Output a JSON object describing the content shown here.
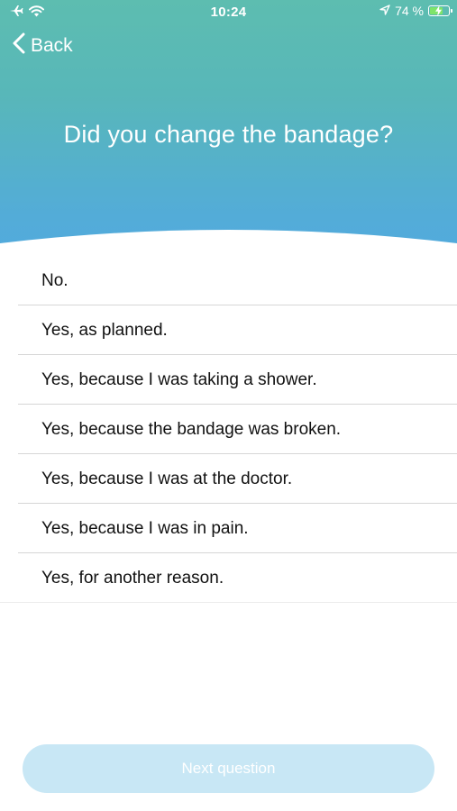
{
  "status_bar": {
    "time": "10:24",
    "battery_text": "74 %",
    "battery_level": 0.74,
    "icons": [
      "airplane-icon",
      "wifi-icon",
      "location-arrow-icon",
      "battery-charging-icon"
    ]
  },
  "nav": {
    "back_label": "Back"
  },
  "question": {
    "title": "Did you change the bandage?"
  },
  "options": [
    {
      "label": "No."
    },
    {
      "label": "Yes, as planned."
    },
    {
      "label": "Yes, because I was taking a shower."
    },
    {
      "label": "Yes, because the bandage was broken."
    },
    {
      "label": "Yes, because I was at the doctor."
    },
    {
      "label": "Yes, because I was in pain."
    },
    {
      "label": "Yes, for another reason."
    }
  ],
  "footer": {
    "next_label": "Next question",
    "next_enabled": false
  },
  "colors": {
    "header_top": "#5dbdb0",
    "header_bottom": "#52a9df",
    "next_button_disabled": "#c8e7f5",
    "battery_fill": "#7ee46a"
  }
}
